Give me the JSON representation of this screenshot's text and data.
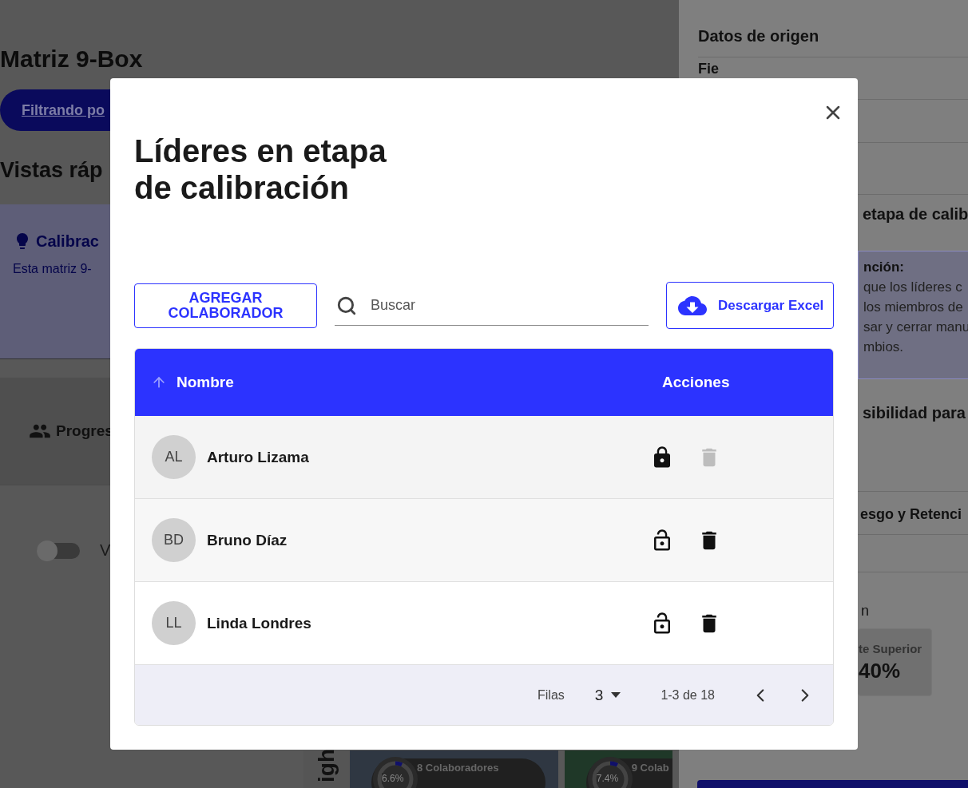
{
  "background": {
    "page_title": "Matriz 9-Box",
    "filter_button": "Filtrando po",
    "section_title": "Vistas ráp",
    "info_card": {
      "title": "Calibrac",
      "text": "Esta matriz 9-"
    },
    "tab": "Progres",
    "toggle": {
      "on": false,
      "label": "V"
    },
    "grid": {
      "axis_label": "igh",
      "cells": [
        {
          "percent": "6.6%",
          "level": 0.066,
          "count": "8 Colaboradores",
          "color": "#2f3742"
        },
        {
          "percent": "7.4%",
          "level": 0.074,
          "count": "9 Colab",
          "color": "#1f3828"
        }
      ]
    }
  },
  "side_panel": {
    "title": "Datos de origen",
    "row": "Fie",
    "section": "etapa de calib",
    "note": {
      "title": "nción:",
      "lines": [
        "que los líderes c",
        "los miembros de",
        "sar y cerrar manu",
        "mbios."
      ]
    },
    "section_2": "sibilidad para",
    "section_3": "esgo y Retenci",
    "label": "n",
    "stat": {
      "label": "te Superior",
      "value": "40%"
    }
  },
  "modal": {
    "title": "Líderes en etapa\nde calibración",
    "add_button": "AGREGAR\nCOLABORADOR",
    "search": {
      "placeholder": "Buscar"
    },
    "download_button": "Descargar Excel",
    "table": {
      "columns": [
        {
          "label": "Nombre",
          "sorted": true
        },
        {
          "label": "Acciones",
          "sorted": false
        }
      ],
      "rows": [
        {
          "initials": "AL",
          "name": "Arturo Lizama",
          "locked": true,
          "delete_disabled": true
        },
        {
          "initials": "BD",
          "name": "Bruno Díaz",
          "locked": false,
          "delete_disabled": false
        },
        {
          "initials": "LL",
          "name": "Linda Londres",
          "locked": false,
          "delete_disabled": false
        }
      ]
    },
    "pagination": {
      "rows_label": "Filas",
      "rows_per_page": "3",
      "range": "1-3 de 18"
    }
  }
}
